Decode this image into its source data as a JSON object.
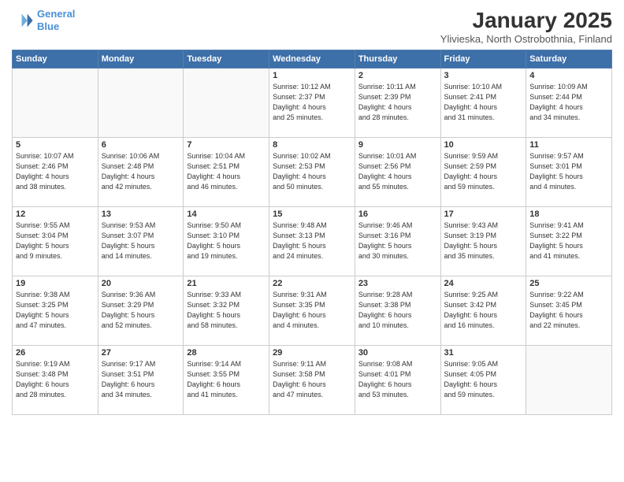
{
  "header": {
    "logo_line1": "General",
    "logo_line2": "Blue",
    "month_title": "January 2025",
    "location": "Ylivieska, North Ostrobothnia, Finland"
  },
  "weekdays": [
    "Sunday",
    "Monday",
    "Tuesday",
    "Wednesday",
    "Thursday",
    "Friday",
    "Saturday"
  ],
  "weeks": [
    [
      {
        "day": "",
        "info": ""
      },
      {
        "day": "",
        "info": ""
      },
      {
        "day": "",
        "info": ""
      },
      {
        "day": "1",
        "info": "Sunrise: 10:12 AM\nSunset: 2:37 PM\nDaylight: 4 hours\nand 25 minutes."
      },
      {
        "day": "2",
        "info": "Sunrise: 10:11 AM\nSunset: 2:39 PM\nDaylight: 4 hours\nand 28 minutes."
      },
      {
        "day": "3",
        "info": "Sunrise: 10:10 AM\nSunset: 2:41 PM\nDaylight: 4 hours\nand 31 minutes."
      },
      {
        "day": "4",
        "info": "Sunrise: 10:09 AM\nSunset: 2:44 PM\nDaylight: 4 hours\nand 34 minutes."
      }
    ],
    [
      {
        "day": "5",
        "info": "Sunrise: 10:07 AM\nSunset: 2:46 PM\nDaylight: 4 hours\nand 38 minutes."
      },
      {
        "day": "6",
        "info": "Sunrise: 10:06 AM\nSunset: 2:48 PM\nDaylight: 4 hours\nand 42 minutes."
      },
      {
        "day": "7",
        "info": "Sunrise: 10:04 AM\nSunset: 2:51 PM\nDaylight: 4 hours\nand 46 minutes."
      },
      {
        "day": "8",
        "info": "Sunrise: 10:02 AM\nSunset: 2:53 PM\nDaylight: 4 hours\nand 50 minutes."
      },
      {
        "day": "9",
        "info": "Sunrise: 10:01 AM\nSunset: 2:56 PM\nDaylight: 4 hours\nand 55 minutes."
      },
      {
        "day": "10",
        "info": "Sunrise: 9:59 AM\nSunset: 2:59 PM\nDaylight: 4 hours\nand 59 minutes."
      },
      {
        "day": "11",
        "info": "Sunrise: 9:57 AM\nSunset: 3:01 PM\nDaylight: 5 hours\nand 4 minutes."
      }
    ],
    [
      {
        "day": "12",
        "info": "Sunrise: 9:55 AM\nSunset: 3:04 PM\nDaylight: 5 hours\nand 9 minutes."
      },
      {
        "day": "13",
        "info": "Sunrise: 9:53 AM\nSunset: 3:07 PM\nDaylight: 5 hours\nand 14 minutes."
      },
      {
        "day": "14",
        "info": "Sunrise: 9:50 AM\nSunset: 3:10 PM\nDaylight: 5 hours\nand 19 minutes."
      },
      {
        "day": "15",
        "info": "Sunrise: 9:48 AM\nSunset: 3:13 PM\nDaylight: 5 hours\nand 24 minutes."
      },
      {
        "day": "16",
        "info": "Sunrise: 9:46 AM\nSunset: 3:16 PM\nDaylight: 5 hours\nand 30 minutes."
      },
      {
        "day": "17",
        "info": "Sunrise: 9:43 AM\nSunset: 3:19 PM\nDaylight: 5 hours\nand 35 minutes."
      },
      {
        "day": "18",
        "info": "Sunrise: 9:41 AM\nSunset: 3:22 PM\nDaylight: 5 hours\nand 41 minutes."
      }
    ],
    [
      {
        "day": "19",
        "info": "Sunrise: 9:38 AM\nSunset: 3:25 PM\nDaylight: 5 hours\nand 47 minutes."
      },
      {
        "day": "20",
        "info": "Sunrise: 9:36 AM\nSunset: 3:29 PM\nDaylight: 5 hours\nand 52 minutes."
      },
      {
        "day": "21",
        "info": "Sunrise: 9:33 AM\nSunset: 3:32 PM\nDaylight: 5 hours\nand 58 minutes."
      },
      {
        "day": "22",
        "info": "Sunrise: 9:31 AM\nSunset: 3:35 PM\nDaylight: 6 hours\nand 4 minutes."
      },
      {
        "day": "23",
        "info": "Sunrise: 9:28 AM\nSunset: 3:38 PM\nDaylight: 6 hours\nand 10 minutes."
      },
      {
        "day": "24",
        "info": "Sunrise: 9:25 AM\nSunset: 3:42 PM\nDaylight: 6 hours\nand 16 minutes."
      },
      {
        "day": "25",
        "info": "Sunrise: 9:22 AM\nSunset: 3:45 PM\nDaylight: 6 hours\nand 22 minutes."
      }
    ],
    [
      {
        "day": "26",
        "info": "Sunrise: 9:19 AM\nSunset: 3:48 PM\nDaylight: 6 hours\nand 28 minutes."
      },
      {
        "day": "27",
        "info": "Sunrise: 9:17 AM\nSunset: 3:51 PM\nDaylight: 6 hours\nand 34 minutes."
      },
      {
        "day": "28",
        "info": "Sunrise: 9:14 AM\nSunset: 3:55 PM\nDaylight: 6 hours\nand 41 minutes."
      },
      {
        "day": "29",
        "info": "Sunrise: 9:11 AM\nSunset: 3:58 PM\nDaylight: 6 hours\nand 47 minutes."
      },
      {
        "day": "30",
        "info": "Sunrise: 9:08 AM\nSunset: 4:01 PM\nDaylight: 6 hours\nand 53 minutes."
      },
      {
        "day": "31",
        "info": "Sunrise: 9:05 AM\nSunset: 4:05 PM\nDaylight: 6 hours\nand 59 minutes."
      },
      {
        "day": "",
        "info": ""
      }
    ]
  ]
}
